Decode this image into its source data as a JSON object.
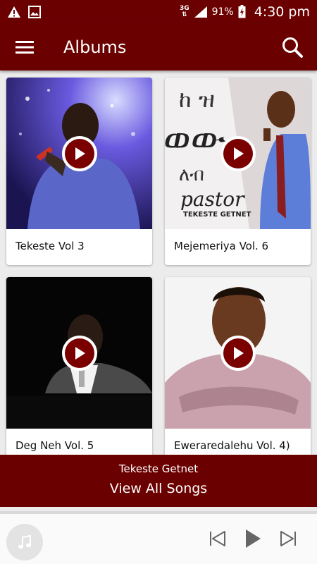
{
  "status_bar": {
    "network": "3G",
    "battery": "91%",
    "time": "4:30 pm"
  },
  "header": {
    "title": "Albums"
  },
  "albums": [
    {
      "name": "Tekeste Vol 3"
    },
    {
      "name": "Mejemeriya Vol. 6",
      "art_text_1": "pastor",
      "art_text_2": "TEKESTE GETNET"
    },
    {
      "name": "Deg Neh Vol. 5"
    },
    {
      "name": "Eweraredalehu Vol. 4)"
    }
  ],
  "banner": {
    "artist": "Tekeste Getnet",
    "view_all": "View All Songs"
  },
  "colors": {
    "primary": "#6b0000",
    "play_accent": "#7a0000"
  }
}
